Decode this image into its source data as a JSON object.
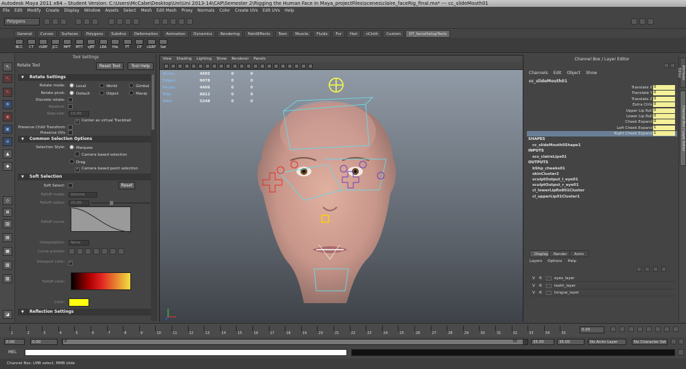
{
  "window": {
    "title": "Autodesk Maya 2011 x64 – Student Version: C:\\Users\\McCabe\\Desktop\\Uni\\Uni 2013-14\\CAP\\Semester 2\\Rigging the Human Face in Maya_projectFiles\\scenes\\claire_faceRig_final.ma* --- cc_slideMouth01"
  },
  "menubar": [
    "File",
    "Edit",
    "Modify",
    "Create",
    "Display",
    "Window",
    "Assets",
    "Select",
    "Mesh",
    "Edit Mesh",
    "Proxy",
    "Normals",
    "Color",
    "Create UVs",
    "Edit UVs",
    "Help"
  ],
  "status": {
    "mode": "Polygons"
  },
  "shelf_tabs": [
    "General",
    "Curves",
    "Surfaces",
    "Polygons",
    "Subdivs",
    "Deformation",
    "Animation",
    "Dynamics",
    "Rendering",
    "PaintEffects",
    "Toon",
    "Muscle",
    "Fluids",
    "Fur",
    "Hair",
    "nCloth",
    "Custom",
    "DT_facialSetupTools"
  ],
  "shelf_buttons": [
    "BCC",
    "CT",
    "rGRP",
    "JCC",
    "MPT",
    "MTT",
    "vJRT",
    "LRA",
    "Hie",
    "FT",
    "CP",
    "cGRP",
    "Set"
  ],
  "tool_settings": {
    "header": "Tool Settings",
    "tool_name": "Rotate Tool",
    "reset_tool": "Reset Tool",
    "tool_help": "Tool Help",
    "rotate_section": "Rotate Settings",
    "rotate_mode_label": "Rotate mode:",
    "rotate_modes": [
      "Local",
      "World",
      "Gimbal"
    ],
    "rotate_pivot_label": "Rotate pivot:",
    "rotate_pivots": [
      "Default",
      "Object",
      "Manip"
    ],
    "discrete_label": "Discrete rotate:",
    "relative_label": "Relative:",
    "step_label": "Step size:",
    "step_value": "15.00",
    "trackball": "Center as virtual Trackball",
    "preserve_child": "Preserve Child Transform",
    "preserve_uvs": "Preserve UVs",
    "common_section": "Common Selection Options",
    "sel_style_label": "Selection Style:",
    "sel_marquee": "Marquee",
    "sel_camera": "Camera based selection",
    "sel_drag": "Drag",
    "sel_camera_paint": "Camera based paint selection",
    "soft_section": "Soft Selection",
    "soft_select_label": "Soft Select:",
    "reset": "Reset",
    "falloff_mode_label": "Falloff mode:",
    "falloff_mode_value": "Volume",
    "falloff_radius_label": "Falloff radius:",
    "falloff_radius_value": "20.00",
    "falloff_curve_label": "Falloff curve:",
    "interpolation_label": "Interpolation:",
    "interpolation_value": "None",
    "curve_presets_label": "Curve presets:",
    "viewport_color_label": "Viewport color:",
    "falloff_color_label": "Falloff color:",
    "color_label": "Color:",
    "reflection_section": "Reflection Settings"
  },
  "viewport": {
    "menu": [
      "View",
      "Shading",
      "Lighting",
      "Show",
      "Renderer",
      "Panels"
    ],
    "hud": [
      {
        "label": "Verts:",
        "a": "4695",
        "b": "0",
        "c": "0"
      },
      {
        "label": "Edges:",
        "a": "9078",
        "b": "0",
        "c": "0"
      },
      {
        "label": "Faces:",
        "a": "4406",
        "b": "0",
        "c": "0"
      },
      {
        "label": "Tris:",
        "a": "8812",
        "b": "0",
        "c": "0"
      },
      {
        "label": "UVs:",
        "a": "5248",
        "b": "0",
        "c": "0"
      }
    ]
  },
  "channel_box": {
    "header": "Channel Box / Layer Editor",
    "menu": [
      "Channels",
      "Edit",
      "Object",
      "Show"
    ],
    "object": "cc_slideMouth01",
    "channels": [
      {
        "name": "Translate X",
        "value": "0"
      },
      {
        "name": "Translate Y",
        "value": "0"
      },
      {
        "name": "Translate Z",
        "value": "0"
      },
      {
        "name": "Extra Ctrls",
        "value": "0"
      },
      {
        "name": "Upper Lip Roll",
        "value": "0"
      },
      {
        "name": "Lower Lip Roll",
        "value": "0"
      },
      {
        "name": "Cheek Expand",
        "value": "0"
      },
      {
        "name": "Left Cheek Expand",
        "value": "1"
      },
      {
        "name": "Right Cheek Expand",
        "value": "1"
      }
    ],
    "shapes_label": "SHAPES",
    "shapes": [
      "cc_slideMouth0Shape1"
    ],
    "inputs_label": "INPUTS",
    "inputs": [
      "scs_claireLips01"
    ],
    "outputs_label": "OUTPUTS",
    "outputs": [
      "bShp_cheeks01",
      "skinCluster2",
      "sculptOutput_l_eye01",
      "sculptOutput_r_eye01",
      "cl_lowerLipRo801Cluster",
      "cl_upperLip01Cluster1"
    ]
  },
  "layer_editor": {
    "tabs": [
      "Display",
      "Render",
      "Anim"
    ],
    "menu": [
      "Layers",
      "Options",
      "Help"
    ],
    "layers": [
      {
        "v": "V",
        "r": "R",
        "name": "eyes_layer"
      },
      {
        "v": "V",
        "r": "R",
        "name": "teeth_layer"
      },
      {
        "v": "V",
        "r": "R",
        "name": "tongue_layer"
      }
    ]
  },
  "side_tabs": [
    "Attribute Editor",
    "Channel Box / Layer Editor"
  ],
  "timeline": {
    "ticks": [
      "1",
      "2",
      "3",
      "4",
      "5",
      "6",
      "7",
      "8",
      "9",
      "10",
      "11",
      "12",
      "13",
      "14",
      "15",
      "16",
      "17",
      "18",
      "19",
      "20",
      "21",
      "22",
      "23",
      "24",
      "25",
      "26",
      "27",
      "28",
      "29",
      "30",
      "31",
      "32",
      "33",
      "34",
      "35"
    ],
    "current": "0.00"
  },
  "range": {
    "start": "0.00",
    "start2": "0.00",
    "slider_start": "0",
    "slider_end": "35",
    "end": "35.00",
    "end2": "35.00",
    "anim_layer": "No Anim Layer",
    "char_set": "No Character Set"
  },
  "mel": {
    "label": "MEL"
  },
  "help": {
    "text": "Channel Box: LMB select, MMB slide"
  }
}
